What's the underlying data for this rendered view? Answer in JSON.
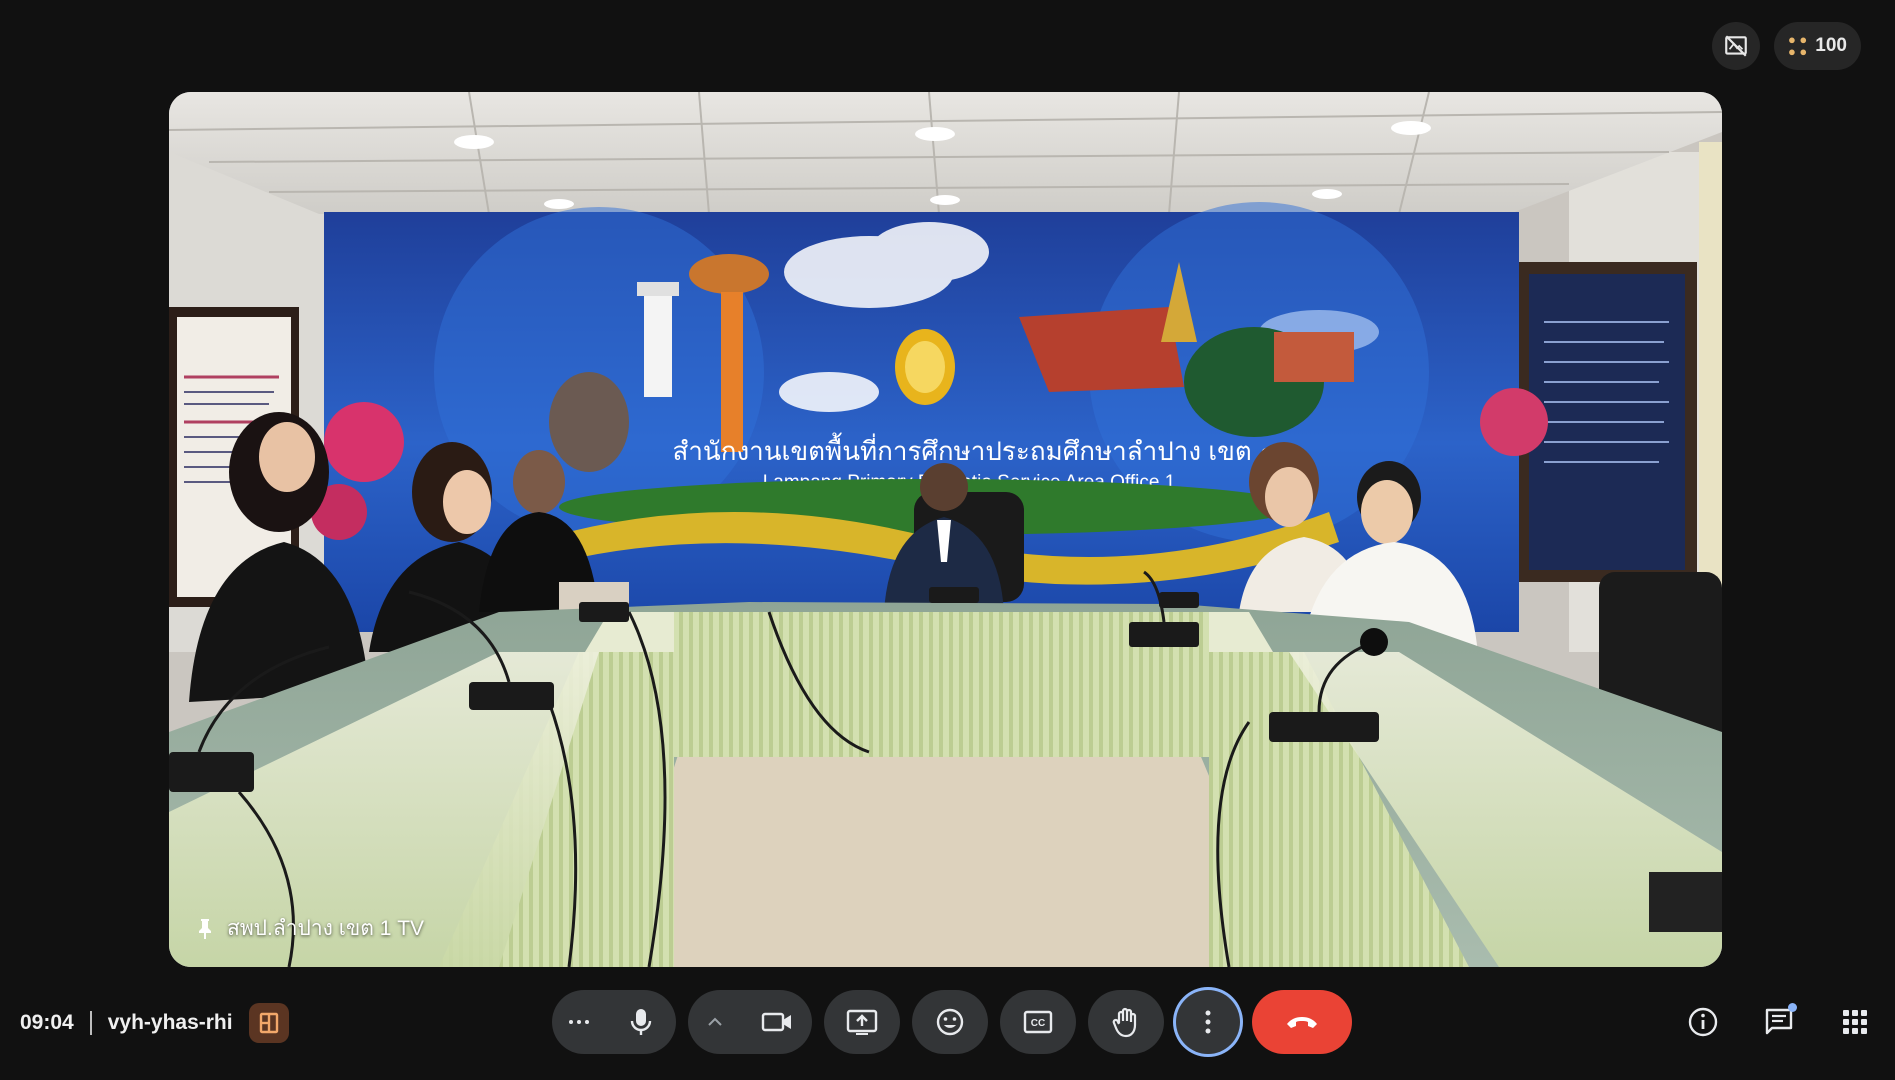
{
  "window": {
    "reactions_count": "100"
  },
  "tile": {
    "participant_name": "สพป.ลำปาง เขต 1 TV",
    "banner_th": "สำนักงานเขตพื้นที่การศึกษาประถมศึกษาลำปาง เขต ๑",
    "banner_en": "Lampang Primary Educatio   Service Area Office 1"
  },
  "meeting": {
    "time": "09:04",
    "code": "vyh-yhas-rhi"
  },
  "icons": {
    "no_paint": "no-paint-icon",
    "reactions": "reactions-icon",
    "pin": "pin-icon",
    "host_controls": "host-controls-icon",
    "more_options": "more-horiz-icon",
    "mic": "mic-icon",
    "chevron_up": "chevron-up-icon",
    "camera": "camera-icon",
    "present": "present-screen-icon",
    "emoji": "emoji-icon",
    "captions": "captions-icon",
    "raise_hand": "raise-hand-icon",
    "more_vert": "more-vert-icon",
    "end_call": "end-call-icon",
    "info": "info-icon",
    "chat": "chat-icon",
    "apps": "apps-icon"
  },
  "colors": {
    "end_call": "#ea4335",
    "focus_ring": "#8ab4f8",
    "control_bg": "#333537",
    "background": "#111111"
  }
}
